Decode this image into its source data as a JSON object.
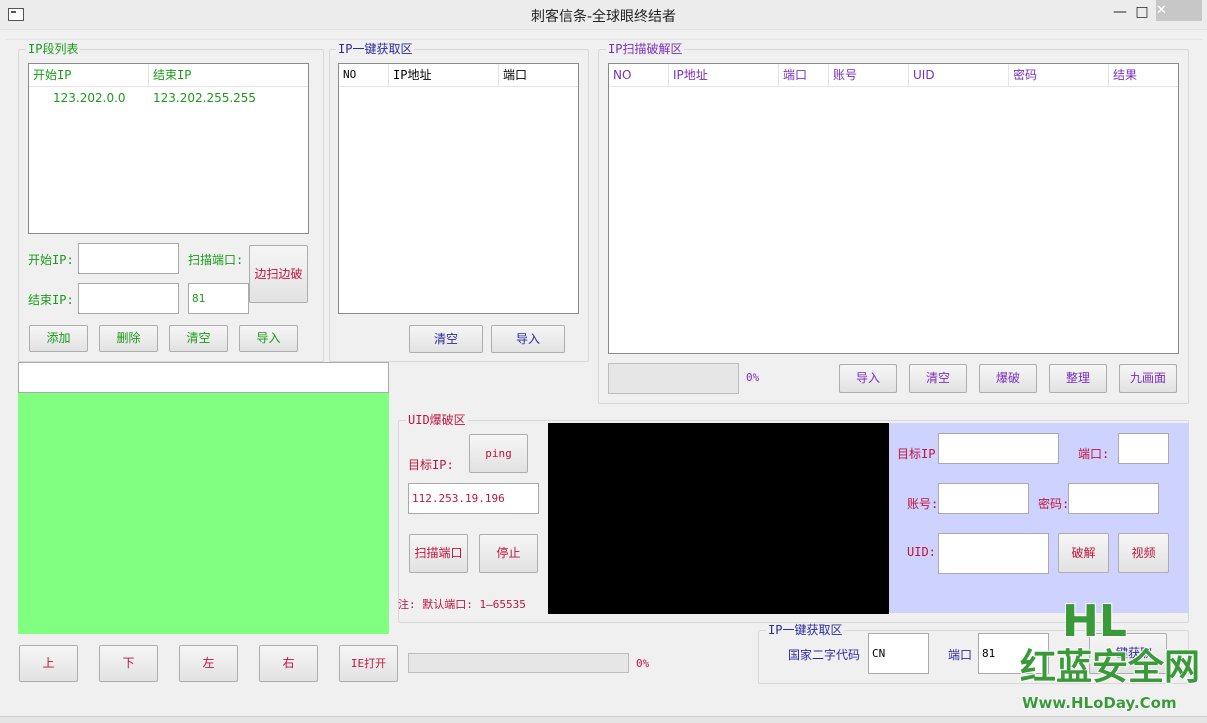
{
  "window": {
    "title": "刺客信条-全球眼终结者",
    "minimize": "—",
    "maximize": "□",
    "close": "✕"
  },
  "ip_list": {
    "title": "IP段列表",
    "columns": [
      "开始IP",
      "结束IP"
    ],
    "rows": [
      {
        "start": "123.202.0.0",
        "end": "123.202.255.255"
      }
    ],
    "start_label": "开始IP:",
    "end_label": "结束IP:",
    "port_label": "扫描端口:",
    "start_value": "",
    "end_value": "",
    "port_value": "81",
    "scan_crack_button": "边扫边破",
    "buttons": {
      "add": "添加",
      "delete": "删除",
      "clear": "清空",
      "import": "导入"
    }
  },
  "ip_get": {
    "title": "IP一键获取区",
    "columns": [
      "NO",
      "IP地址",
      "端口"
    ],
    "buttons": {
      "clear": "清空",
      "import": "导入"
    }
  },
  "scan_crack": {
    "title": "IP扫描破解区",
    "columns": [
      "NO",
      "IP地址",
      "端口",
      "账号",
      "UID",
      "密码",
      "结果"
    ],
    "progress_text": "0%",
    "progress": 0,
    "buttons": {
      "import": "导入",
      "clear": "清空",
      "crack": "爆破",
      "sort": "整理",
      "nine": "九画面"
    }
  },
  "preview": {
    "input_value": "",
    "panel_color": "#80ff80"
  },
  "nav": {
    "up": "上",
    "down": "下",
    "left": "左",
    "right": "右",
    "ie": "IE打开",
    "progress_text": "0%",
    "progress": 0
  },
  "uid_crack": {
    "title": "UID爆破区",
    "target_label": "目标IP:",
    "ping_button": "ping",
    "target_value": "112.253.19.196",
    "scan_port_button": "扫描端口",
    "stop_button": "停止",
    "note": "注: 默认端口: 1—65535"
  },
  "target": {
    "ip_label": "目标IP:",
    "port_label": "端口:",
    "account_label": "账号:",
    "password_label": "密码:",
    "uid_label": "UID:",
    "crack_button": "破解",
    "video_button": "视频",
    "panel_color": "#cdd2ff"
  },
  "ip_get2": {
    "title": "IP一键获取区",
    "country_label": "国家二字代码",
    "country_value": "CN",
    "port_label": "端口",
    "port_value": "81",
    "get_button": "一键获取"
  },
  "watermark": {
    "line1": "HL",
    "line2": "红蓝安全网",
    "line3": "Www.HLoDay.Com"
  }
}
